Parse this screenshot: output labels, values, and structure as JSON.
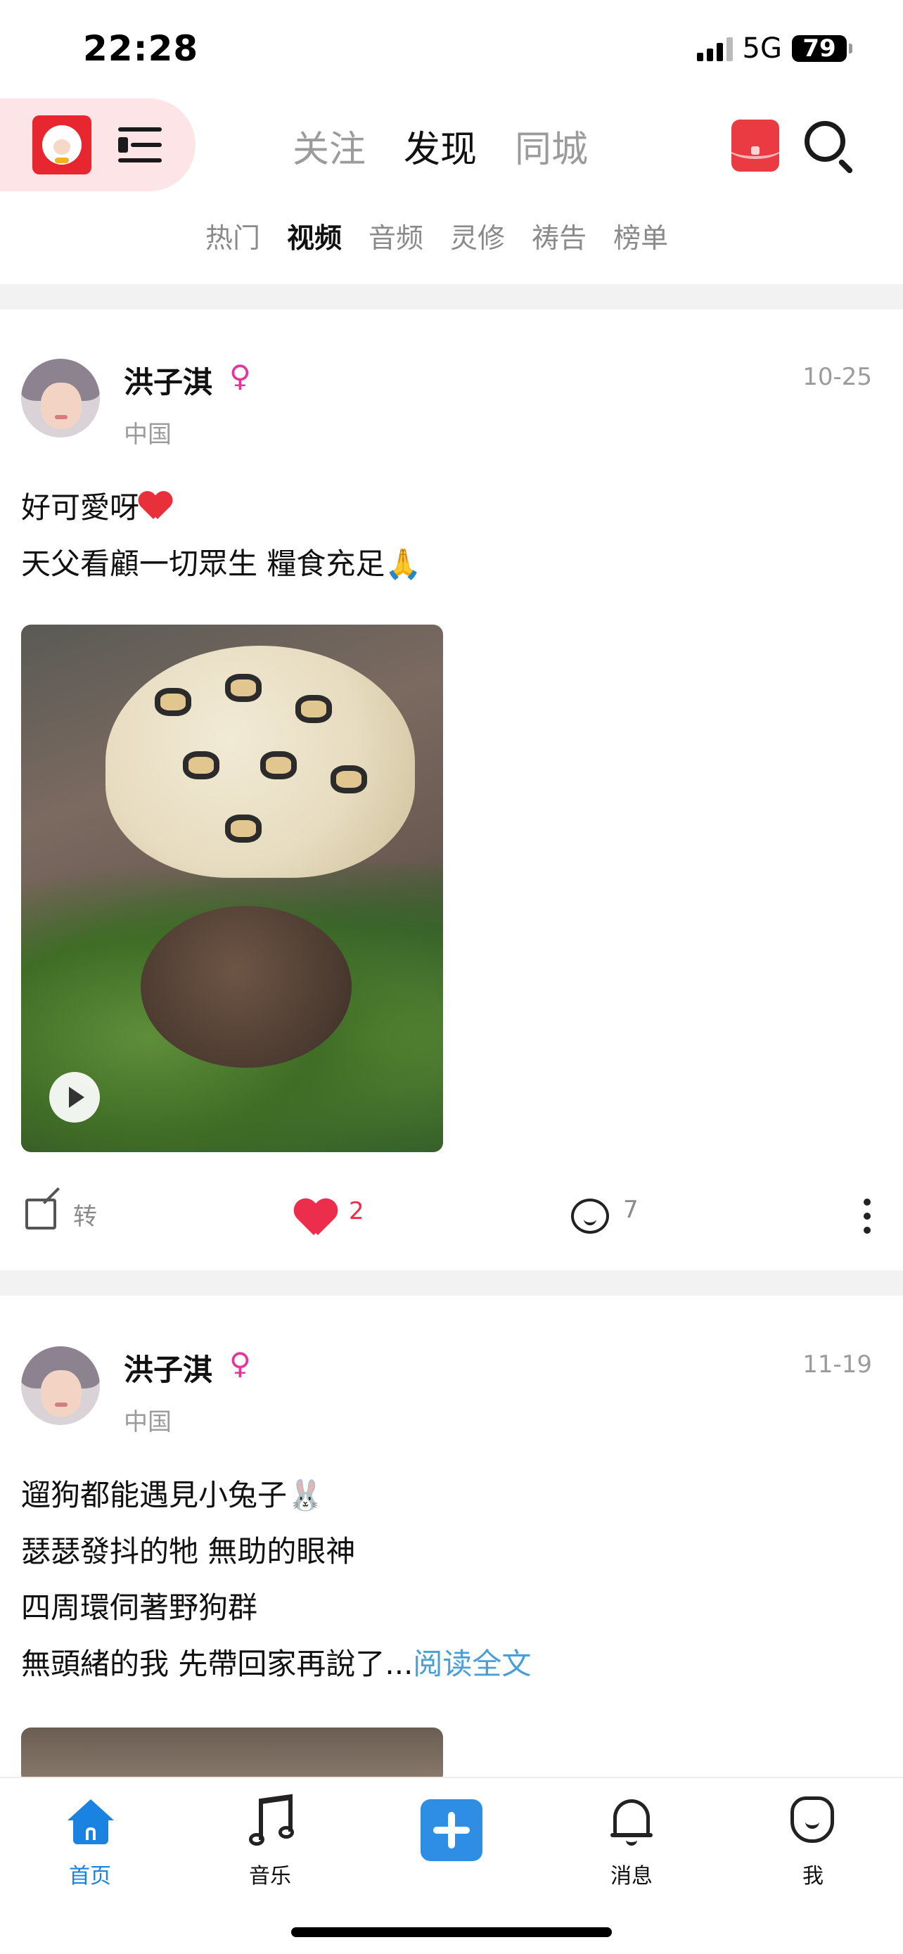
{
  "status_bar": {
    "time": "22:28",
    "network": "5G",
    "battery": "79"
  },
  "header": {
    "main_tabs": [
      {
        "label": "关注",
        "active": false
      },
      {
        "label": "发现",
        "active": true
      },
      {
        "label": "同城",
        "active": false
      }
    ],
    "sub_tabs": [
      {
        "label": "热门",
        "active": false
      },
      {
        "label": "视频",
        "active": true
      },
      {
        "label": "音频",
        "active": false
      },
      {
        "label": "灵修",
        "active": false
      },
      {
        "label": "祷告",
        "active": false
      },
      {
        "label": "榜单",
        "active": false
      }
    ]
  },
  "posts": [
    {
      "author": "洪子淇",
      "gender_symbol": "♀",
      "location": "中国",
      "date": "10-25",
      "lines": [
        "好可愛呀",
        "天父看顧一切眾生 糧食充足🙏"
      ],
      "share_label": "转",
      "likes": "2",
      "comments": "7"
    },
    {
      "author": "洪子淇",
      "gender_symbol": "♀",
      "location": "中国",
      "date": "11-19",
      "lines": [
        "遛狗都能遇見小兔子🐰",
        "瑟瑟發抖的牠 無助的眼神",
        "四周環伺著野狗群",
        "無頭緒的我 先帶回家再說了..."
      ],
      "read_more": "阅读全文"
    }
  ],
  "bottom_nav": [
    {
      "label": "首页",
      "icon": "home-icon",
      "active": true
    },
    {
      "label": "音乐",
      "icon": "music-icon",
      "active": false
    },
    {
      "label": "",
      "icon": "plus-icon",
      "active": false
    },
    {
      "label": "消息",
      "icon": "bell-icon",
      "active": false
    },
    {
      "label": "我",
      "icon": "profile-icon",
      "active": false
    }
  ],
  "colors": {
    "accent_blue": "#1a82e0",
    "like_red": "#ec2d4b",
    "gender_pink": "#e5359b",
    "link_blue": "#4aa0d6"
  }
}
